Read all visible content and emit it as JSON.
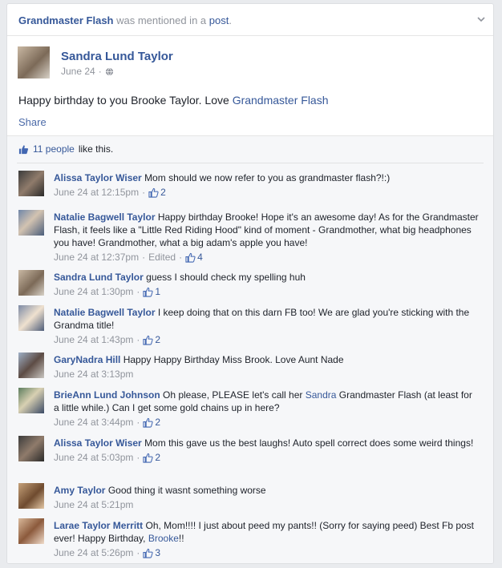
{
  "mention": {
    "page_name": "Grandmaster Flash",
    "was_mentioned_in": "was mentioned in a",
    "post_word": "post",
    "period": "."
  },
  "post": {
    "author": "Sandra Lund Taylor",
    "date": "June 24",
    "separator": "·",
    "text_before": "Happy birthday to you Brooke Taylor. Love",
    "text_link": "Grandmaster Flash",
    "share_label": "Share"
  },
  "likes": {
    "people_link": "11 people",
    "suffix": "like this."
  },
  "icons": {
    "mention_menu": "chevron-down-icon",
    "privacy": "globe-icon",
    "like": "thumbs-up-icon"
  },
  "colors": {
    "link_blue": "#365899",
    "meta_gray": "#90949c",
    "background": "#e9ebee"
  },
  "comments": [
    {
      "author": "Alissa Taylor Wiser",
      "text": "Mom should we now refer to you as grandmaster flash?!:)",
      "time": "June 24 at 12:15pm",
      "likes": "2"
    },
    {
      "author": "Natalie Bagwell Taylor",
      "text": "Happy birthday Brooke! Hope it's an awesome day! As for the Grandmaster Flash, it feels like a \"Little Red Riding Hood\" kind of moment - Grandmother, what big headphones you have! Grandmother, what a big adam's apple you have!",
      "time": "June 24 at 12:37pm",
      "edited": "Edited",
      "likes": "4"
    },
    {
      "author": "Sandra Lund Taylor",
      "text": "guess I should check my spelling huh",
      "time": "June 24 at 1:30pm",
      "likes": "1"
    },
    {
      "author": "Natalie Bagwell Taylor",
      "text": "I keep doing that on this darn FB too! We are glad you're sticking with the Grandma title!",
      "time": "June 24 at 1:43pm",
      "likes": "2"
    },
    {
      "author": "GaryNadra Hill",
      "text": "Happy Happy Birthday Miss Brook. Love Aunt Nade",
      "time": "June 24 at 3:13pm"
    },
    {
      "author": "BrieAnn Lund Johnson",
      "text_before": "Oh please, PLEASE let's call her",
      "text_link": "Sandra",
      "text_after": "Grandmaster Flash (at least for a little while.) Can I get some gold chains up in here?",
      "time": "June 24 at 3:44pm",
      "likes": "2"
    },
    {
      "author": "Alissa Taylor Wiser",
      "text": "Mom this gave us the best laughs! Auto spell correct does some weird things!",
      "time": "June 24 at 5:03pm",
      "likes": "2"
    },
    {
      "author": "Amy Taylor",
      "text": "Good thing it wasnt something worse",
      "time": "June 24 at 5:21pm"
    },
    {
      "author": "Larae Taylor Merritt",
      "text_before": "Oh, Mom!!!! I just about peed my pants!! (Sorry for saying peed) Best Fb post ever! Happy Birthday,",
      "text_link": "Brooke",
      "text_after": "!!",
      "time": "June 24 at 5:26pm",
      "likes": "3"
    }
  ]
}
